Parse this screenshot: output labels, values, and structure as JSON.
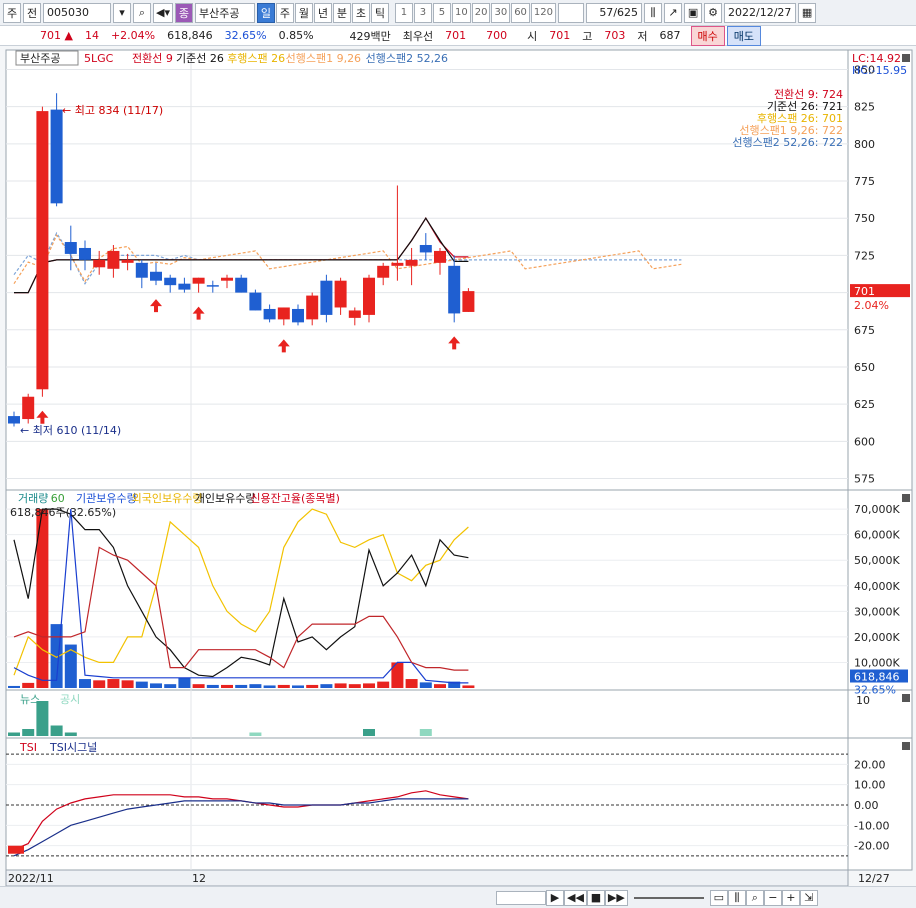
{
  "toolbar": {
    "mode": "주",
    "market": "전",
    "code": "005030",
    "stock_name": "부산주공",
    "badge": "종",
    "periods": [
      "일",
      "주",
      "월",
      "년",
      "분",
      "초",
      "틱"
    ],
    "active_period": "일",
    "intervals": [
      "1",
      "3",
      "5",
      "10",
      "20",
      "30",
      "60",
      "120"
    ],
    "count": "57",
    "total": "/625",
    "date": "2022/12/27"
  },
  "info": {
    "price": "701 ▲",
    "change": "14",
    "change_pct": "+2.04%",
    "volume": "618,846",
    "vol_ratio": "32.65%",
    "turnover": "0.85%",
    "amount": "429백만",
    "best_label": "최우선",
    "best_ask": "701",
    "best_bid": "700",
    "open_label": "시",
    "open": "701",
    "high_label": "고",
    "high": "703",
    "low_label": "저",
    "low": "687",
    "buy": "매수",
    "sell": "매도"
  },
  "main_legend": {
    "name": "부산주공",
    "ma": "5LGC",
    "items": [
      {
        "label": "전환선 9",
        "color": "#d0021b"
      },
      {
        "label": "기준선 26",
        "color": "#111111"
      },
      {
        "label": "후행스팬 26",
        "color": "#e8b400"
      },
      {
        "label": "선행스팬1 9,26",
        "color": "#f5a15a"
      },
      {
        "label": "선행스팬2 52,26",
        "color": "#3a6fb5"
      }
    ],
    "lc": "LC:14.92",
    "hc": "HC:-15.95"
  },
  "right_values": [
    {
      "label": "전환선 9: 724",
      "color": "#d0021b"
    },
    {
      "label": "기준선 26: 721",
      "color": "#111111"
    },
    {
      "label": "후행스팬 26: 701",
      "color": "#e8b400"
    },
    {
      "label": "선행스팬1 9,26: 722",
      "color": "#f5a15a"
    },
    {
      "label": "선행스팬2 52,26: 722",
      "color": "#3a6fb5"
    }
  ],
  "annotations": {
    "high": "최고 834 (11/17)",
    "low": "최저 610 (11/14)"
  },
  "price_tag": {
    "value": "701",
    "pct": "2.04%"
  },
  "vol_legend": {
    "items": [
      {
        "label": "거래량",
        "color": "#1a8a8a"
      },
      {
        "label": "60",
        "color": "#3aa03a"
      },
      {
        "label": "기관보유수량",
        "color": "#1a4fd6"
      },
      {
        "label": "외국인보유수량",
        "color": "#e8b400"
      },
      {
        "label": "개인보유수량",
        "color": "#111111"
      },
      {
        "label": "신용잔고율(종목별)",
        "color": "#d0021b"
      }
    ],
    "current": "618,846주(32.65%)",
    "tag1": "618,846",
    "tag2": "32.65%"
  },
  "news_legend": {
    "items": [
      {
        "label": "뉴스",
        "color": "#3aa08a"
      },
      {
        "label": "공시",
        "color": "#8fd8c0"
      }
    ],
    "axis": "10"
  },
  "tsi_legend": {
    "items": [
      {
        "label": "TSI",
        "color": "#d0021b"
      },
      {
        "label": "TSI시그널",
        "color": "#1a2f8a"
      }
    ]
  },
  "x_labels": [
    {
      "label": "2022/11"
    },
    {
      "label": "12"
    }
  ],
  "x_right": "12/27",
  "chart_data": [
    {
      "type": "candlestick",
      "y_ticks": [
        850,
        825,
        800,
        775,
        750,
        725,
        700,
        675,
        650,
        625,
        600,
        575
      ],
      "ylim": [
        570,
        855
      ],
      "candles": [
        {
          "o": 617,
          "h": 620,
          "l": 610,
          "c": 612
        },
        {
          "o": 615,
          "h": 632,
          "l": 612,
          "c": 630
        },
        {
          "o": 635,
          "h": 825,
          "l": 630,
          "c": 822
        },
        {
          "o": 823,
          "h": 834,
          "l": 758,
          "c": 760
        },
        {
          "o": 734,
          "h": 745,
          "l": 715,
          "c": 726
        },
        {
          "o": 730,
          "h": 735,
          "l": 715,
          "c": 722
        },
        {
          "o": 717,
          "h": 728,
          "l": 712,
          "c": 722
        },
        {
          "o": 716,
          "h": 732,
          "l": 710,
          "c": 728
        },
        {
          "o": 720,
          "h": 726,
          "l": 715,
          "c": 722
        },
        {
          "o": 720,
          "h": 722,
          "l": 703,
          "c": 710
        },
        {
          "o": 714,
          "h": 720,
          "l": 705,
          "c": 708
        },
        {
          "o": 710,
          "h": 712,
          "l": 700,
          "c": 705
        },
        {
          "o": 706,
          "h": 710,
          "l": 700,
          "c": 702
        },
        {
          "o": 706,
          "h": 710,
          "l": 700,
          "c": 710
        },
        {
          "o": 705,
          "h": 708,
          "l": 700,
          "c": 704
        },
        {
          "o": 708,
          "h": 712,
          "l": 703,
          "c": 710
        },
        {
          "o": 710,
          "h": 712,
          "l": 700,
          "c": 700
        },
        {
          "o": 700,
          "h": 702,
          "l": 688,
          "c": 688
        },
        {
          "o": 689,
          "h": 692,
          "l": 680,
          "c": 682
        },
        {
          "o": 682,
          "h": 690,
          "l": 678,
          "c": 690
        },
        {
          "o": 689,
          "h": 692,
          "l": 678,
          "c": 680
        },
        {
          "o": 682,
          "h": 700,
          "l": 678,
          "c": 698
        },
        {
          "o": 708,
          "h": 712,
          "l": 680,
          "c": 685
        },
        {
          "o": 690,
          "h": 710,
          "l": 685,
          "c": 708
        },
        {
          "o": 683,
          "h": 690,
          "l": 678,
          "c": 688
        },
        {
          "o": 685,
          "h": 712,
          "l": 680,
          "c": 710
        },
        {
          "o": 710,
          "h": 720,
          "l": 705,
          "c": 718
        },
        {
          "o": 718,
          "h": 772,
          "l": 708,
          "c": 720
        },
        {
          "o": 718,
          "h": 730,
          "l": 705,
          "c": 722
        },
        {
          "o": 732,
          "h": 740,
          "l": 722,
          "c": 727
        },
        {
          "o": 720,
          "h": 730,
          "l": 712,
          "c": 728
        },
        {
          "o": 718,
          "h": 725,
          "l": 680,
          "c": 686
        },
        {
          "o": 687,
          "h": 703,
          "l": 687,
          "c": 701
        }
      ],
      "tenkan": [
        700,
        700,
        720,
        722,
        722,
        722,
        722,
        722,
        722,
        722,
        722,
        722,
        722,
        722,
        722,
        722,
        722,
        722,
        722,
        722,
        722,
        722,
        722,
        722,
        722,
        722,
        722,
        722,
        735,
        750,
        734,
        724,
        724
      ],
      "kijun": [
        700,
        700,
        720,
        722,
        722,
        722,
        722,
        722,
        722,
        722,
        722,
        722,
        722,
        722,
        722,
        722,
        722,
        722,
        722,
        722,
        722,
        722,
        722,
        722,
        722,
        722,
        722,
        722,
        735,
        750,
        735,
        721,
        721
      ],
      "lagging": [
        712,
        725,
        720,
        740,
        725,
        706,
        720,
        725,
        725,
        725,
        725,
        722,
        725,
        722,
        722,
        722,
        722,
        722,
        722,
        722,
        722,
        722,
        722,
        722,
        722,
        722,
        722,
        722,
        722,
        722,
        722,
        722,
        722,
        722,
        722,
        722,
        722,
        722,
        722,
        722,
        722,
        722,
        722,
        722,
        722,
        722,
        722,
        722
      ],
      "signals": [
        2,
        10,
        13,
        19,
        31
      ]
    },
    {
      "type": "bar+line",
      "y_ticks": [
        "70,000K",
        "60,000K",
        "50,000K",
        "40,000K",
        "30,000K",
        "20,000K",
        "10,000K"
      ],
      "ylim": [
        0,
        72000
      ],
      "volume": [
        800,
        2000,
        70000,
        25000,
        17000,
        3500,
        3000,
        3500,
        3000,
        2500,
        1800,
        1500,
        4000,
        1500,
        1200,
        1200,
        1200,
        1500,
        1000,
        1200,
        1000,
        1200,
        1500,
        1800,
        1500,
        1800,
        2500,
        10000,
        3500,
        2200,
        1500,
        2500,
        1000
      ],
      "institution": [
        8000,
        5000,
        3000,
        3000,
        70000,
        5000,
        4500,
        4000,
        4000,
        4000,
        4000,
        4000,
        4000,
        4000,
        4000,
        4000,
        4000,
        4000,
        4000,
        4000,
        4000,
        4000,
        4000,
        4000,
        4000,
        4000,
        4000,
        10000,
        10000,
        3000,
        2500,
        2000,
        2000
      ],
      "foreign": [
        5000,
        20000,
        15000,
        12000,
        15000,
        12000,
        10000,
        10000,
        20000,
        20000,
        40000,
        65000,
        60000,
        55000,
        40000,
        30000,
        25000,
        22000,
        30000,
        55000,
        65000,
        70000,
        68000,
        57000,
        55000,
        58000,
        60000,
        45000,
        42000,
        48000,
        50000,
        58000,
        63000
      ],
      "individual": [
        58000,
        35000,
        70000,
        70000,
        68000,
        62000,
        62000,
        55000,
        40000,
        30000,
        20000,
        15000,
        8000,
        5000,
        4500,
        8000,
        12000,
        11000,
        9000,
        35000,
        18000,
        20000,
        15000,
        20000,
        24000,
        54000,
        40000,
        45000,
        52000,
        40000,
        58000,
        52000,
        51000
      ],
      "credit": [
        20000,
        22000,
        20000,
        20000,
        20000,
        22000,
        55000,
        52000,
        50000,
        45000,
        40000,
        8000,
        8000,
        15000,
        15000,
        15000,
        15000,
        15000,
        12000,
        8000,
        20000,
        25000,
        25000,
        25000,
        25000,
        28000,
        28000,
        20000,
        10000,
        8000,
        8000,
        7000,
        7000
      ]
    },
    {
      "type": "bar",
      "name": "뉴스/공시",
      "ylim": [
        0,
        12
      ],
      "news": [
        1,
        2,
        10,
        3,
        1,
        0,
        0,
        0,
        0,
        0,
        0,
        0,
        0,
        0,
        0,
        0,
        0,
        0,
        0,
        0,
        0,
        0,
        0,
        0,
        0,
        2,
        0,
        0,
        0,
        0,
        0,
        0,
        0
      ],
      "disclosure": [
        0,
        0,
        0,
        0,
        0,
        0,
        0,
        0,
        0,
        0,
        0,
        0,
        0,
        0,
        0,
        0,
        0,
        1,
        0,
        0,
        0,
        0,
        0,
        0,
        0,
        0,
        0,
        0,
        0,
        2,
        0,
        0,
        0
      ]
    },
    {
      "type": "line",
      "y_ticks": [
        "20.00",
        "10.00",
        "0.00",
        "-10.00",
        "-20.00"
      ],
      "ylim": [
        -30,
        30
      ],
      "tsi": [
        -22,
        -19,
        -8,
        -2,
        1,
        3,
        4,
        5,
        5,
        5,
        5,
        5,
        4,
        4,
        3,
        3,
        2,
        1,
        0,
        -1,
        -1,
        0,
        0,
        0,
        1,
        2,
        3,
        4,
        6,
        7,
        5,
        4,
        3
      ],
      "tsi_signal": [
        -25,
        -22,
        -18,
        -14,
        -10,
        -8,
        -6,
        -4,
        -2,
        -1,
        0,
        1,
        2,
        2,
        2,
        2,
        2,
        1,
        1,
        0,
        0,
        0,
        0,
        0,
        1,
        1,
        2,
        3,
        3,
        3,
        3,
        3,
        3
      ]
    }
  ]
}
